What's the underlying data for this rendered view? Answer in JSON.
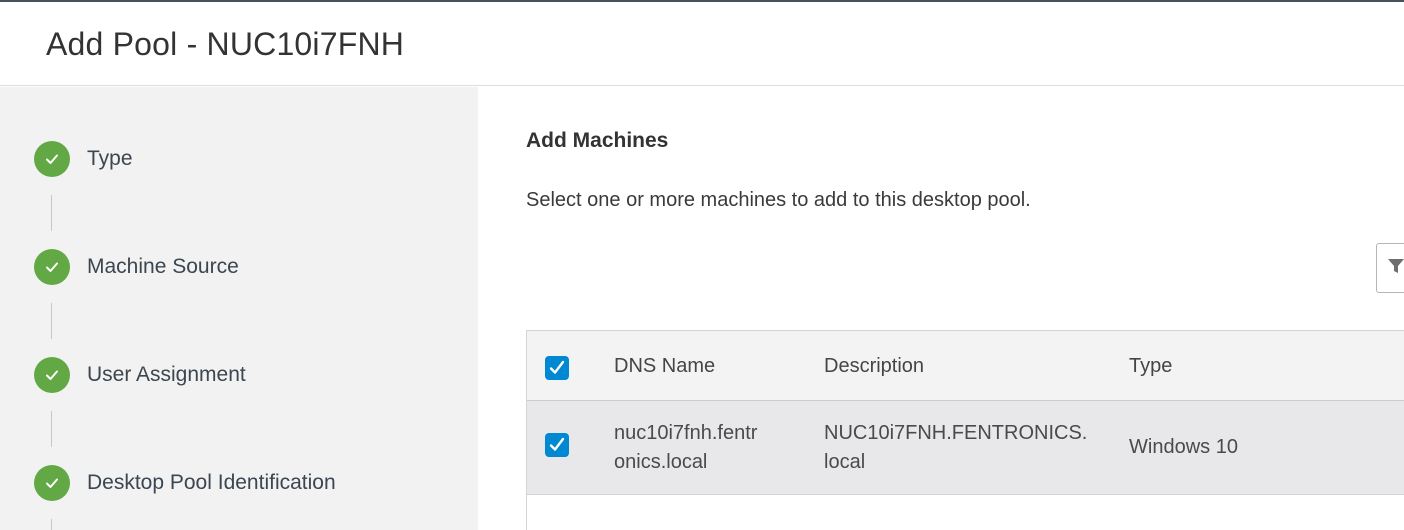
{
  "header": {
    "title": "Add Pool - NUC10i7FNH"
  },
  "wizard": {
    "steps": [
      {
        "label": "Type",
        "status": "complete",
        "icon": "check-icon"
      },
      {
        "label": "Machine Source",
        "status": "complete",
        "icon": "check-icon"
      },
      {
        "label": "User Assignment",
        "status": "complete",
        "icon": "check-icon"
      },
      {
        "label": "Desktop Pool Identification",
        "status": "complete",
        "icon": "check-icon"
      }
    ]
  },
  "main": {
    "section_title": "Add Machines",
    "instructions": "Select one or more machines to add to this desktop pool.",
    "filter_icon": "filter-icon",
    "table": {
      "columns": [
        "DNS Name",
        "Description",
        "Type"
      ],
      "select_all_checked": true,
      "rows": [
        {
          "checked": true,
          "dns_name_line1": "nuc10i7fnh.fentr",
          "dns_name_line2": "onics.local",
          "description_line1": "NUC10i7FNH.FENTRONICS.",
          "description_line2": "local",
          "type": "Windows 10"
        }
      ]
    }
  },
  "colors": {
    "accent": "#0088d2",
    "success": "#62a844",
    "sidebar_bg": "#f2f2f2",
    "selected_row": "#e8e8ea"
  }
}
